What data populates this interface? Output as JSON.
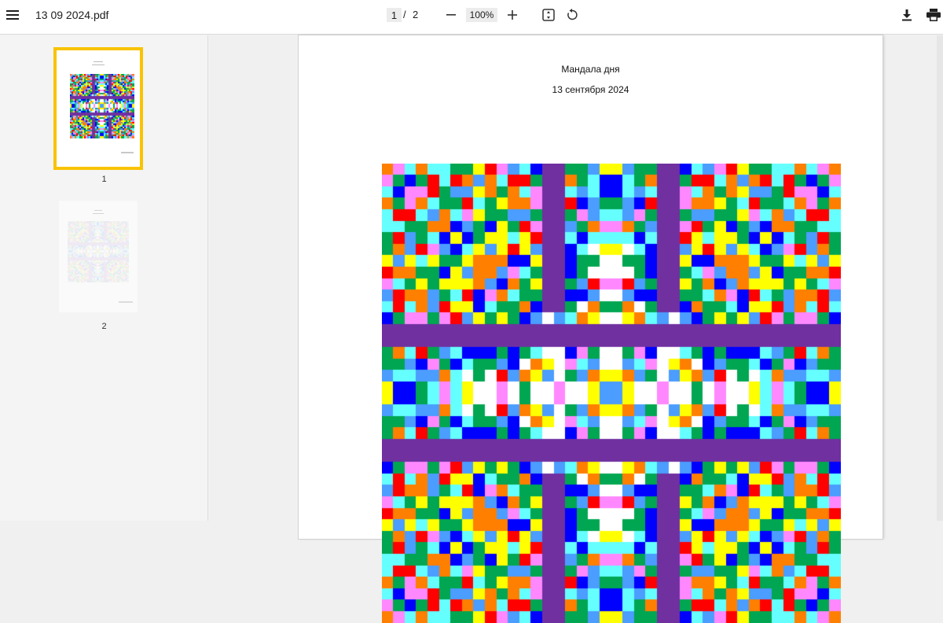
{
  "toolbar": {
    "file_name": "13 09 2024.pdf",
    "current_page": "1",
    "separator": "/",
    "total_pages": "2",
    "zoom": "100%",
    "icons": [
      "menu-icon",
      "zoom-out-icon",
      "zoom-in-icon",
      "fit-page-icon",
      "rotate-icon",
      "download-icon",
      "print-icon"
    ]
  },
  "sidebar": {
    "thumbnails": [
      {
        "label": "1",
        "selected": true
      },
      {
        "label": "2",
        "selected": false
      }
    ],
    "selected_color": "#f9c300"
  },
  "document": {
    "title": "Мандала дня",
    "date": "13 сентября 2024"
  },
  "mandala": {
    "palette": [
      "#ff0000",
      "#ff7f00",
      "#ffff00",
      "#00a651",
      "#0000ff",
      "#4b9dff",
      "#66ffff",
      "#ff88ff",
      "#7030a0",
      "#ffffff"
    ],
    "band_color": "#7030a0"
  }
}
